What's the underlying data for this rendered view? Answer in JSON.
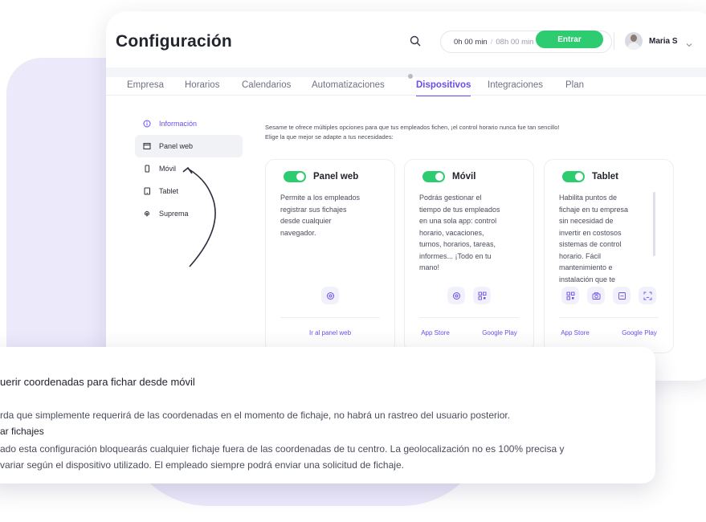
{
  "header": {
    "title": "Configuración",
    "timer_worked": "0h 00 min",
    "timer_separator": "/",
    "timer_total": "08h 00 min",
    "enter_label": "Entrar",
    "user_name": "Maria S"
  },
  "tabs": [
    {
      "label": "Empresa",
      "active": false
    },
    {
      "label": "Horarios",
      "active": false
    },
    {
      "label": "Calendarios",
      "active": false
    },
    {
      "label": "Automatizaciones",
      "active": false
    },
    {
      "label": "Dispositivos",
      "active": true
    },
    {
      "label": "Integraciones",
      "active": false
    },
    {
      "label": "Plan",
      "active": false
    }
  ],
  "sidebar": {
    "items": [
      {
        "label": "Información",
        "icon": "info-icon"
      },
      {
        "label": "Panel web",
        "icon": "monitor-icon"
      },
      {
        "label": "Móvil",
        "icon": "phone-icon"
      },
      {
        "label": "Tablet",
        "icon": "tablet-icon"
      },
      {
        "label": "Suprema",
        "icon": "fingerprint-icon"
      }
    ]
  },
  "intro": {
    "line1": "Sesame te ofrece múltiples opciones para que tus empleados fichen, ¡el control horario nunca fue tan sencillo!",
    "line2": "Elige la que mejor se adapte a tus necesidades:"
  },
  "devices": [
    {
      "title": "Panel web",
      "lines": [
        "Permite a los empleados",
        "registrar sus fichajes",
        "desde cualquier",
        "navegador."
      ],
      "icons": [
        "location-pin-icon"
      ],
      "links": [
        "Ir al panel web"
      ]
    },
    {
      "title": "Móvil",
      "lines": [
        "Podrás gestionar el",
        "tiempo de tus empleados",
        "en una sola app: control",
        "horario, vacaciones,",
        "turnos, horarios, tareas,",
        "informes... ¡Todo en tu",
        "mano!"
      ],
      "icons": [
        "location-pin-icon",
        "qr-code-icon"
      ],
      "links": [
        "App Store",
        "Google Play"
      ]
    },
    {
      "title": "Tablet",
      "lines": [
        "Habilita puntos de",
        "fichaje en tu empresa",
        "sin necesidad de",
        "invertir en costosos",
        "sistemas de control",
        "horario. Fácil",
        "mantenimiento e",
        "instalación que te"
      ],
      "icons": [
        "qr-code-icon",
        "camera-icon",
        "keypad-icon",
        "face-scan-icon"
      ],
      "links": [
        "App Store",
        "Google Play"
      ]
    }
  ],
  "overlay": {
    "title": "uerir coordenadas para fichar desde móvil",
    "line1": "rda que simplemente requerirá de las coordenadas en el momento de fichaje, no habrá un rastreo del usuario posterior.",
    "subtitle": "ar fichajes",
    "line2": "ado esta configuración bloquearás cualquier fichaje fuera de las coordenadas de tu centro. La geolocalización no es 100% precisa y",
    "line3": "variar según el dispositivo utilizado. El empleado siempre podrá enviar una solicitud de fichaje."
  },
  "colors": {
    "accent": "#6c4cf0",
    "toggle_on": "#2ecc71",
    "background_blob": "#ece9fb"
  }
}
